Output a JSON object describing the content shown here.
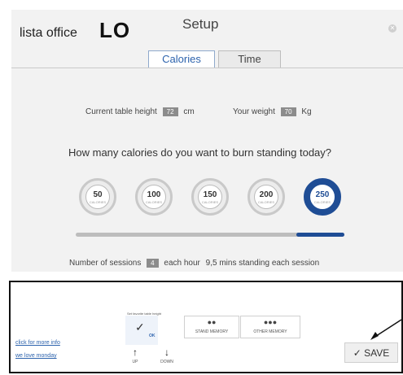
{
  "header": {
    "brand": "lista office",
    "brand_mark": "LO",
    "title": "Setup",
    "close_icon": "close-icon"
  },
  "tabs": [
    {
      "label": "Calories",
      "active": true
    },
    {
      "label": "Time",
      "active": false
    }
  ],
  "height": {
    "label": "Current table height",
    "value": "72",
    "unit": "cm"
  },
  "weight": {
    "label": "Your weight",
    "value": "70",
    "unit": "Kg"
  },
  "question": "How many calories do you want to burn standing today?",
  "calorie_options": [
    {
      "value": "50",
      "unit": "CALORIES"
    },
    {
      "value": "100",
      "unit": "CALORIES"
    },
    {
      "value": "150",
      "unit": "CALORIES"
    },
    {
      "value": "200",
      "unit": "CALORIES"
    },
    {
      "value": "250",
      "unit": "CALORIES",
      "selected": true
    }
  ],
  "slider": {
    "fraction": 0.18
  },
  "sessions": {
    "label": "Number of sessions",
    "value": "4",
    "per_hour": "each hour",
    "standing": "9,5 mins standing each session"
  },
  "panel": {
    "title": "Set favorite table height",
    "ok_label": "OK",
    "stand_memory": "STAND MEMORY",
    "other_memory": "OTHER MEMORY",
    "up_label": "UP",
    "down_label": "DOWN",
    "stand_dots": "●●",
    "other_dots": "●●●"
  },
  "links": {
    "more_info": "click for more info",
    "love": "we love monday"
  },
  "save_label": "SAVE",
  "colors": {
    "accent": "#1f4d95",
    "link": "#2d63ad",
    "value_box": "#8c8c8c"
  }
}
